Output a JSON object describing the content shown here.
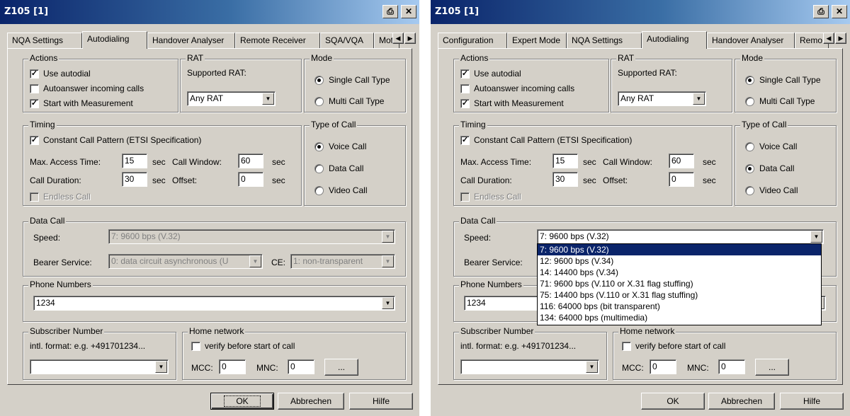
{
  "left": {
    "title": "Z105 [1]",
    "tabs": [
      "NQA Settings",
      "Autodialing",
      "Handover Analyser",
      "Remote Receiver",
      "SQA/VQA",
      "Mot"
    ],
    "type_of_call_selected": "Voice Call"
  },
  "right": {
    "title": "Z105 [1]",
    "tabs": [
      "Configuration",
      "Expert Mode",
      "NQA Settings",
      "Autodialing",
      "Handover Analyser",
      "Remo"
    ],
    "type_of_call_selected": "Data Call"
  },
  "title_icons": {
    "print": "printer-icon",
    "close": "close-icon"
  },
  "actions": {
    "title": "Actions",
    "use_autodial": "Use autodial",
    "use_autodial_checked": true,
    "autoanswer": "Autoanswer incoming calls",
    "autoanswer_checked": false,
    "start_measurement": "Start with Measurement",
    "start_measurement_checked": true
  },
  "rat": {
    "title": "RAT",
    "supported_label": "Supported RAT:",
    "value": "Any RAT"
  },
  "mode": {
    "title": "Mode",
    "single": "Single Call Type",
    "multi": "Multi Call Type",
    "selected": "Single Call Type"
  },
  "timing": {
    "title": "Timing",
    "constant_pattern": "Constant Call Pattern (ETSI Specification)",
    "constant_pattern_checked": true,
    "max_access_label": "Max. Access Time:",
    "max_access_value": "15",
    "call_duration_label": "Call Duration:",
    "call_duration_value": "30",
    "sec": "sec",
    "call_window_label": "Call Window:",
    "call_window_value": "60",
    "offset_label": "Offset:",
    "offset_value": "0",
    "endless_call": "Endless Call"
  },
  "type_of_call": {
    "title": "Type of Call",
    "voice": "Voice Call",
    "data": "Data Call",
    "video": "Video Call"
  },
  "data_call": {
    "title": "Data Call",
    "speed_label": "Speed:",
    "speed_value": "7: 9600 bps (V.32)",
    "bearer_label": "Bearer Service:",
    "bearer_value": "0: data circuit asynchronous (U",
    "ce_label": "CE:",
    "ce_value": "1: non-transparent",
    "speed_options": [
      "7: 9600 bps (V.32)",
      "12: 9600 bps (V.34)",
      "14: 14400 bps (V.34)",
      "71: 9600 bps (V.110 or X.31 flag stuffing)",
      "75: 14400 bps (V.110 or X.31 flag stuffing)",
      "116: 64000 bps (bit transparent)",
      "134: 64000 bps (multimedia)"
    ]
  },
  "phone_numbers": {
    "title": "Phone Numbers",
    "value": "1234"
  },
  "subscriber": {
    "title": "Subscriber Number",
    "hint": "intl. format: e.g. +491701234...",
    "value": ""
  },
  "home_network": {
    "title": "Home network",
    "verify": "verify before start of call",
    "verify_checked": false,
    "mcc_label": "MCC:",
    "mcc_value": "0",
    "mnc_label": "MNC:",
    "mnc_value": "0",
    "browse": "..."
  },
  "buttons": {
    "ok": "OK",
    "cancel": "Abbrechen",
    "help": "Hilfe"
  }
}
